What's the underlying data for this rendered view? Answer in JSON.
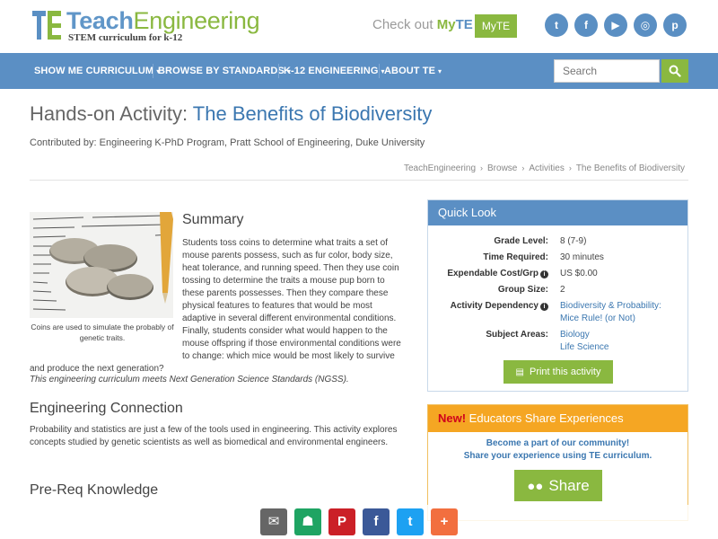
{
  "header": {
    "logo_teach": "Teach",
    "logo_engineering": "Engineering",
    "logo_sub": "STEM curriculum for k-12",
    "checkout_prefix": "Check out ",
    "checkout_my": "My",
    "checkout_te": "TE",
    "myte_button": "MyTE",
    "social": [
      {
        "name": "twitter-icon",
        "glyph": "t"
      },
      {
        "name": "facebook-icon",
        "glyph": "f"
      },
      {
        "name": "youtube-icon",
        "glyph": "▶"
      },
      {
        "name": "instagram-icon",
        "glyph": "◎"
      },
      {
        "name": "pinterest-icon",
        "glyph": "p"
      }
    ]
  },
  "nav": {
    "items": [
      "SHOW ME CURRICULUM",
      "BROWSE BY STANDARDS",
      "K-12 ENGINEERING",
      "ABOUT TE"
    ],
    "search_placeholder": "Search"
  },
  "page": {
    "title_prefix": "Hands-on Activity:",
    "title_main": "The Benefits of Biodiversity",
    "contributed": "Contributed by: Engineering K-PhD Program, Pratt School of Engineering, Duke University",
    "breadcrumbs": [
      "TeachEngineering",
      "Browse",
      "Activities",
      "The Benefits of Biodiversity"
    ]
  },
  "summary": {
    "heading": "Summary",
    "caption": "Coins are used to simulate the probably of genetic traits.",
    "text": "Students toss coins to determine what traits a set of mouse parents possess, such as fur color, body size, heat tolerance, and running speed. Then they use coin tossing to determine the traits a mouse pup born to these parents possesses. Then they compare these physical features to features that would be most adaptive in several different environmental conditions. Finally, students consider what would happen to the mouse offspring if those environmental conditions were to change: which mice would be most likely to survive and produce the next generation?",
    "ngss": "This engineering curriculum meets Next Generation Science Standards (NGSS)."
  },
  "engineering": {
    "heading": "Engineering Connection",
    "text": "Probability and statistics are just a few of the tools used in engineering. This activity explores concepts studied by genetic scientists as well as biomedical and environmental engineers."
  },
  "prereq": {
    "heading": "Pre-Req Knowledge"
  },
  "quick_look": {
    "heading": "Quick Look",
    "grade_label": "Grade Level:",
    "grade_value": "8 (7-9)",
    "time_label": "Time Required:",
    "time_value": "30 minutes",
    "cost_label": "Expendable Cost/Grp",
    "cost_value": "US $0.00",
    "group_label": "Group Size:",
    "group_value": "2",
    "dependency_label": "Activity Dependency",
    "dependency_line1": "Biodiversity & Probability:",
    "dependency_line2": "Mice Rule! (or Not)",
    "subject_label": "Subject Areas:",
    "subject_1": "Biology",
    "subject_2": "Life Science",
    "print_button": "Print this activity"
  },
  "educators": {
    "new": "New!",
    "heading": " Educators Share Experiences",
    "line1": "Become a part of our community!",
    "line2": "Share your experience using TE curriculum.",
    "share_button": "Share"
  },
  "sharebar": {
    "buttons": [
      {
        "name": "email-share-icon",
        "glyph": "✉",
        "color": "#666666"
      },
      {
        "name": "google-classroom-share-icon",
        "glyph": "☗",
        "color": "#1fa463"
      },
      {
        "name": "pinterest-share-icon",
        "glyph": "P",
        "color": "#cb2027"
      },
      {
        "name": "facebook-share-icon",
        "glyph": "f",
        "color": "#3b5998"
      },
      {
        "name": "twitter-share-icon",
        "glyph": "t",
        "color": "#1da1f2"
      },
      {
        "name": "more-share-icon",
        "glyph": "+",
        "color": "#f26f3f"
      }
    ]
  },
  "colors": {
    "brand_blue": "#5b8fc4",
    "brand_green": "#8ab840",
    "link_blue": "#3b77b0",
    "accent_orange": "#f5a623"
  }
}
